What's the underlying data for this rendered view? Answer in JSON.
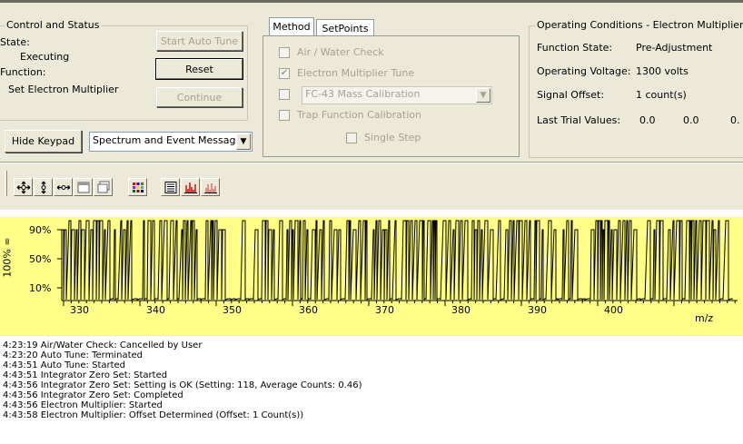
{
  "control_status": {
    "title": "Control and Status",
    "state_label": "State:",
    "state_value": "Executing",
    "function_label": "Function:",
    "function_value": "Set Electron Multiplier",
    "start_auto_tune": "Start Auto Tune",
    "reset": "Reset",
    "continue": "Continue"
  },
  "keypad": {
    "hide_keypad": "Hide Keypad",
    "message_select": "Spectrum and Event Messag"
  },
  "method": {
    "tabs": [
      "Method",
      "SetPoints"
    ],
    "air_water": "Air / Water Check",
    "em_tune": "Electron Multiplier Tune",
    "em_tune_checked": "✔",
    "calibration_select": "FC-43 Mass Calibration",
    "trap_function": "Trap Function Calibration",
    "single_step": "Single Step"
  },
  "operating": {
    "title": "Operating Conditions - Electron Multiplier",
    "function_state_label": "Function State:",
    "function_state_value": "Pre-Adjustment",
    "voltage_label": "Operating Voltage:",
    "voltage_value": "1300 volts",
    "offset_label": "Signal Offset:",
    "offset_value": "1 count(s)",
    "trial_label": "Last Trial Values:",
    "trial_values": [
      "0.0",
      "0.0",
      "0."
    ]
  },
  "toolbar": {
    "icons": [
      "move-icon",
      "zoom-vertical-icon",
      "zoom-horizontal-icon",
      "window-icon",
      "window-restore-icon",
      "colors-icon",
      "list-icon",
      "bar-spectrum-icon",
      "line-spectrum-icon"
    ]
  },
  "spectrum": {
    "ylabel": "100% =",
    "ytick_labels": [
      "90%",
      "50%",
      "10%"
    ],
    "xtick_labels": [
      "330",
      "340",
      "350",
      "360",
      "370",
      "380",
      "390",
      "400"
    ],
    "xunit": "m/z",
    "background": "#ffff88"
  },
  "log": [
    "4:23:19  Air/Water Check: Cancelled by User",
    "4:23:20  Auto Tune: Terminated",
    "4:43:51  Auto Tune: Started",
    "4:43:51  Integrator Zero Set: Started",
    "4:43:56  Integrator Zero Set: Setting is OK (Setting: 118, Average Counts: 0.46)",
    "4:43:56  Integrator Zero Set: Completed",
    "4:43:56  Electron Multiplier: Started",
    "4:43:58  Electron Multiplier: Offset Determined (Offset: 1 Count(s))"
  ]
}
